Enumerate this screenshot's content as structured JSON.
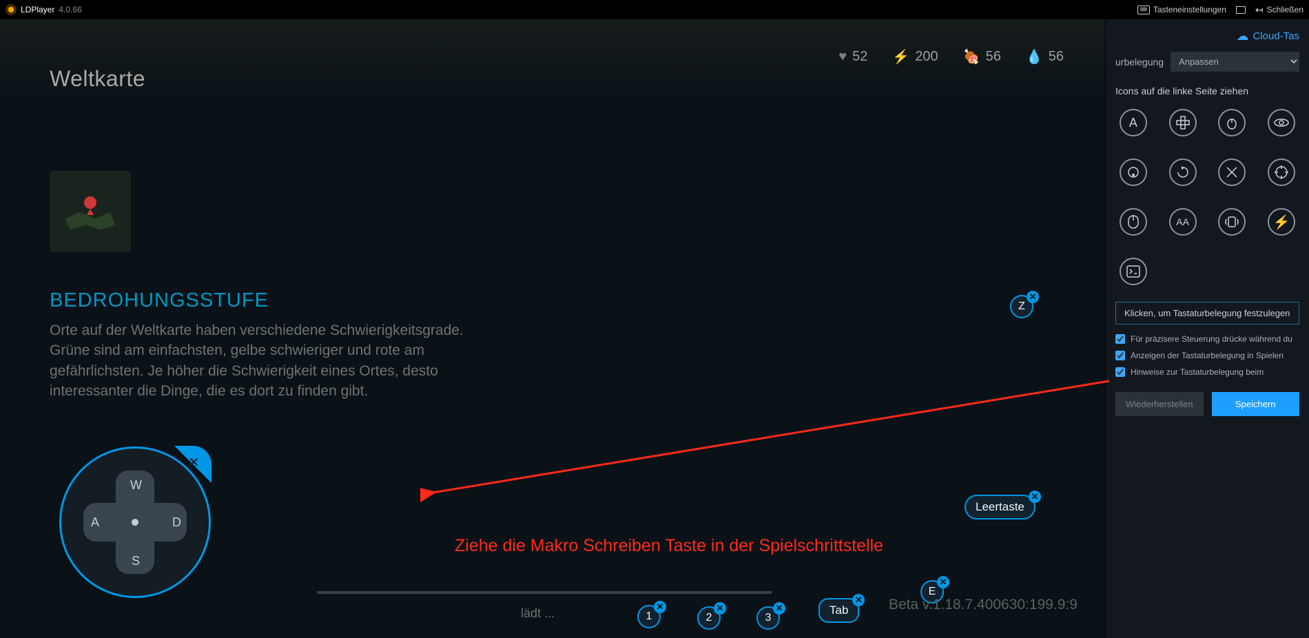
{
  "titlebar": {
    "app_name": "LDPlayer",
    "version": "4.0.66",
    "key_settings": "Tasteneinstellungen",
    "close": "Schließen"
  },
  "game": {
    "title": "Weltkarte",
    "stats": {
      "heart": "52",
      "bolt": "200",
      "meat": "56",
      "water": "56"
    },
    "threat_title": "BEDROHUNGSSTUFE",
    "threat_text": "Orte auf der Weltkarte haben verschiedene Schwierigkeitsgrade. Grüne sind am einfachsten, gelbe schwieriger und rote am gefährlichsten. Je höher die Schwierigkeit eines Ortes, desto interessanter die Dinge, die es dort zu finden gibt.",
    "dpad": {
      "up": "W",
      "left": "A",
      "right": "D",
      "down": "S"
    },
    "keys": {
      "z": "Z",
      "space": "Leertaste",
      "one": "1",
      "two": "2",
      "three": "3",
      "tab": "Tab",
      "e": "E"
    },
    "loading": "lädt ...",
    "version_text": "Beta v.1.18.7.400630:199.9:9"
  },
  "annotation": {
    "text": "Ziehe die Makro Schreiben Taste in der Spielschrittstelle"
  },
  "sidebar": {
    "cloud": "Cloud-Tas",
    "profile_label": "urbelegung",
    "profile_value": "Anpassen",
    "drag_label": "Icons auf die linke Seite ziehen",
    "tooltip": "Klicken, um Tastaturbelegung festzulegen",
    "check1": "Für präzisere Steuerung drücke während du",
    "check2": "Anzeigen der Tastaturbelegung in Spielen",
    "check3": "Hinweise zur Tastaturbelegung beim",
    "restore": "Wiederherstellen",
    "save": "Speichern",
    "icons": {
      "a": "A",
      "aa": "AA"
    }
  }
}
